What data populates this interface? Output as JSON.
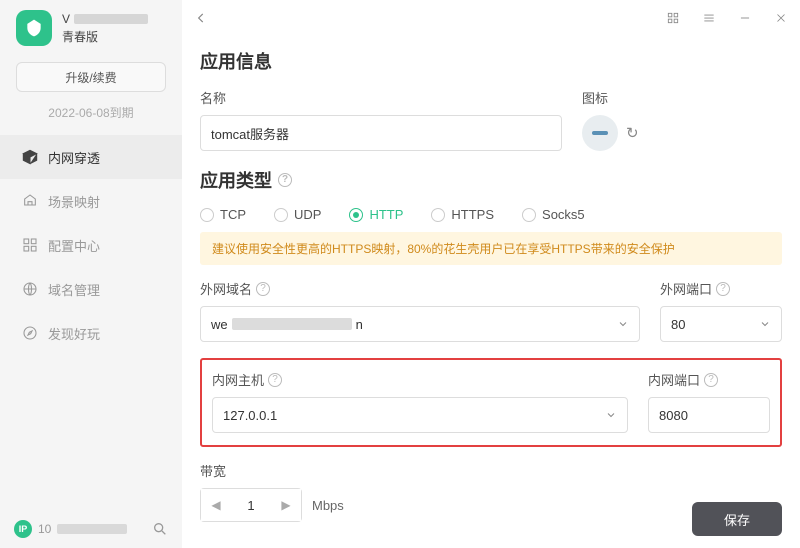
{
  "sidebar": {
    "user_first_char": "V",
    "edition": "青春版",
    "upgrade_label": "升级/续费",
    "expire_text": "2022-06-08到期",
    "nav": [
      {
        "label": "内网穿透"
      },
      {
        "label": "场景映射"
      },
      {
        "label": "配置中心"
      },
      {
        "label": "域名管理"
      },
      {
        "label": "发现好玩"
      }
    ],
    "ip_badge": "IP",
    "ip_prefix": "10"
  },
  "titlebar": {
    "grid_icon": "grid",
    "menu_icon": "menu",
    "min_icon": "minimize",
    "close_icon": "close",
    "back_icon": "back"
  },
  "section_app_info": "应用信息",
  "name_label": "名称",
  "name_value": "tomcat服务器",
  "icon_label": "图标",
  "section_app_type": "应用类型",
  "protocols": [
    {
      "label": "TCP",
      "selected": false
    },
    {
      "label": "UDP",
      "selected": false
    },
    {
      "label": "HTTP",
      "selected": true
    },
    {
      "label": "HTTPS",
      "selected": false
    },
    {
      "label": "Socks5",
      "selected": false
    }
  ],
  "banner_text": "建议使用安全性更高的HTTPS映射，80%的花生壳用户已在享受HTTPS带来的安全保护",
  "ext_domain_label": "外网域名",
  "ext_domain_prefix": "we",
  "ext_domain_suffix": "n",
  "ext_port_label": "外网端口",
  "ext_port_value": "80",
  "int_host_label": "内网主机",
  "int_host_value": "127.0.0.1",
  "int_port_label": "内网端口",
  "int_port_value": "8080",
  "bandwidth_label": "带宽",
  "bandwidth_value": "1",
  "bandwidth_unit": "Mbps",
  "save_label": "保存"
}
